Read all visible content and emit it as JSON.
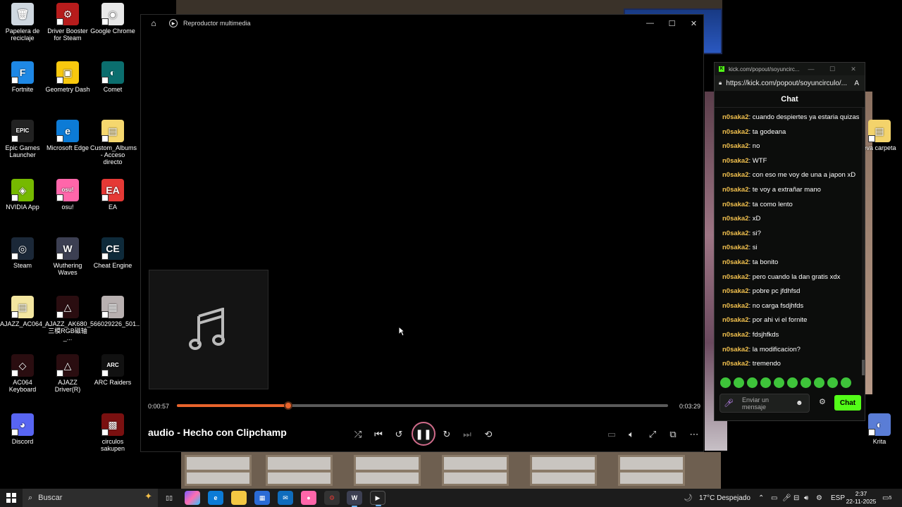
{
  "desktop": {
    "icons": [
      {
        "label": "Papelera de reciclaje",
        "bg": "#cfd8e0",
        "glyph": "🗑"
      },
      {
        "label": "Driver Booster for Steam",
        "bg": "#b71c1c",
        "glyph": "⚙"
      },
      {
        "label": "Google Chrome",
        "bg": "#e8e8e8",
        "glyph": "◉"
      },
      {
        "label": "Fortnite",
        "bg": "#1e88e5",
        "glyph": "F"
      },
      {
        "label": "Geometry Dash",
        "bg": "#f9c80e",
        "glyph": "▣"
      },
      {
        "label": "Comet",
        "bg": "#0b6e6e",
        "glyph": "◐"
      },
      {
        "label": "Epic Games Launcher",
        "bg": "#222222",
        "glyph": "EPIC"
      },
      {
        "label": "Microsoft Edge",
        "bg": "#0c7bd6",
        "glyph": "e"
      },
      {
        "label": "Custom_Albums - Acceso directo",
        "bg": "#f5d76e",
        "glyph": "▤"
      },
      {
        "label": "NVIDIA App",
        "bg": "#76b900",
        "glyph": "◈"
      },
      {
        "label": "osu!",
        "bg": "#ff66aa",
        "glyph": "osu!"
      },
      {
        "label": "EA",
        "bg": "#e53935",
        "glyph": "EA"
      },
      {
        "label": "Steam",
        "bg": "#1b2838",
        "glyph": "◎"
      },
      {
        "label": "Wuthering Waves",
        "bg": "#3c3f52",
        "glyph": "W"
      },
      {
        "label": "Cheat Engine",
        "bg": "#0e2a3a",
        "glyph": "CE"
      },
      {
        "label": "AJAZZ_AC064_...",
        "bg": "#f3e6a0",
        "glyph": "▤"
      },
      {
        "label": "AJAZZ_AK680_三模RGB磁轴_...",
        "bg": "#2a0d10",
        "glyph": "△"
      },
      {
        "label": "566029226_501...",
        "bg": "#b8b0b0",
        "glyph": "▦"
      },
      {
        "label": "AC064 Keyboard",
        "bg": "#2a0d10",
        "glyph": "◇"
      },
      {
        "label": "AJAZZ Driver(R)",
        "bg": "#2a0d10",
        "glyph": "△"
      },
      {
        "label": "ARC Raiders",
        "bg": "#111111",
        "glyph": "ARC"
      },
      {
        "label": "Discord",
        "bg": "#5865f2",
        "glyph": "◕"
      },
      {
        "label": "circulos sakupen",
        "bg": "#7a1010",
        "glyph": "▩"
      },
      {
        "label": "eva carpeta",
        "bg": "#f3d36b",
        "glyph": "▤"
      },
      {
        "label": "Krita",
        "bg": "#5a7dd6",
        "glyph": "◐"
      }
    ]
  },
  "player": {
    "app_title": "Reproductor multimedia",
    "song_title": "audio - Hecho con Clipchamp",
    "time_current": "0:00:57",
    "time_total": "0:03:29",
    "progress": 0.2272,
    "accent": "#e8642c"
  },
  "chat": {
    "window_title": "kick.com/popout/soyuncirc...",
    "url": "https://kick.com/popout/soyuncirculo/...",
    "header": "Chat",
    "username_color": "#f2c14e",
    "messages": [
      {
        "user": "n0saka2",
        "text": "cuando despiertes ya estaria quizas"
      },
      {
        "user": "n0saka2",
        "text": "ta godeana"
      },
      {
        "user": "n0saka2",
        "text": "no"
      },
      {
        "user": "n0saka2",
        "text": "WTF"
      },
      {
        "user": "n0saka2",
        "text": "con eso me voy de una a japon xD"
      },
      {
        "user": "n0saka2",
        "text": "te voy a extrañar mano"
      },
      {
        "user": "n0saka2",
        "text": "ta como lento"
      },
      {
        "user": "n0saka2",
        "text": "xD"
      },
      {
        "user": "n0saka2",
        "text": "si?"
      },
      {
        "user": "n0saka2",
        "text": "si"
      },
      {
        "user": "n0saka2",
        "text": "ta bonito"
      },
      {
        "user": "n0saka2",
        "text": "pero cuando la dan gratis xdx"
      },
      {
        "user": "n0saka2",
        "text": "pobre pc jfdhfsd"
      },
      {
        "user": "n0saka2",
        "text": "no carga fsdjhfds"
      },
      {
        "user": "n0saka2",
        "text": "por ahi vi el fornite"
      },
      {
        "user": "n0saka2",
        "text": "fdsjhfkds"
      },
      {
        "user": "n0saka2",
        "text": "la modificacion?"
      },
      {
        "user": "n0saka2",
        "text": "tremendo"
      }
    ],
    "input_placeholder": "Enviar un mensaje",
    "send_label": "Chat",
    "send_color": "#53fc18"
  },
  "taskbar": {
    "search_placeholder": "Buscar",
    "weather": "17°C  Despejado",
    "language": "ESP",
    "time": "2:37",
    "date": "22-11-2025",
    "notif_count": "5"
  }
}
